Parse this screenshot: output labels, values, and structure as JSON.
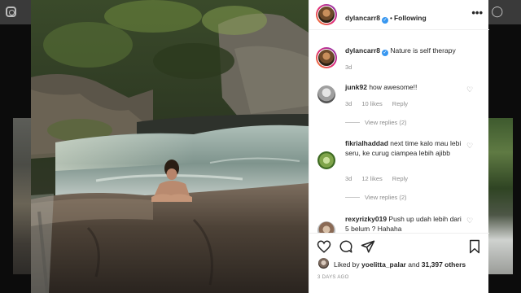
{
  "post": {
    "author": "dylancarr8",
    "follow_status": "Following",
    "caption": "Nature is self therapy",
    "caption_age": "3d",
    "likes_user": "yoelitta_palar",
    "likes_others": "31,397 others",
    "liked_by_prefix": "Liked by",
    "and": "and",
    "posted_ago": "3 DAYS AGO"
  },
  "comments": [
    {
      "user": "junk92",
      "text": "how awesome!!",
      "age": "3d",
      "likes": "10 likes",
      "reply": "Reply",
      "view_replies": "View replies (2)"
    },
    {
      "user": "fikrialhaddad",
      "text": "next time kalo mau lebi seru, ke curug ciampea lebih ajibb",
      "age": "3d",
      "likes": "12 likes",
      "reply": "Reply",
      "view_replies": "View replies (2)"
    },
    {
      "user": "rexyrizky019",
      "text": "Push up udah lebih dari 5 belum ? Hahaha"
    }
  ],
  "icons": {
    "verified": "verified-badge-icon",
    "more": "more-options-icon",
    "like": "heart-icon",
    "comment": "comment-icon",
    "share": "share-icon",
    "save": "bookmark-icon"
  },
  "colors": {
    "verified": "#3897f0",
    "muted": "#8e8e8e",
    "text": "#262626"
  }
}
